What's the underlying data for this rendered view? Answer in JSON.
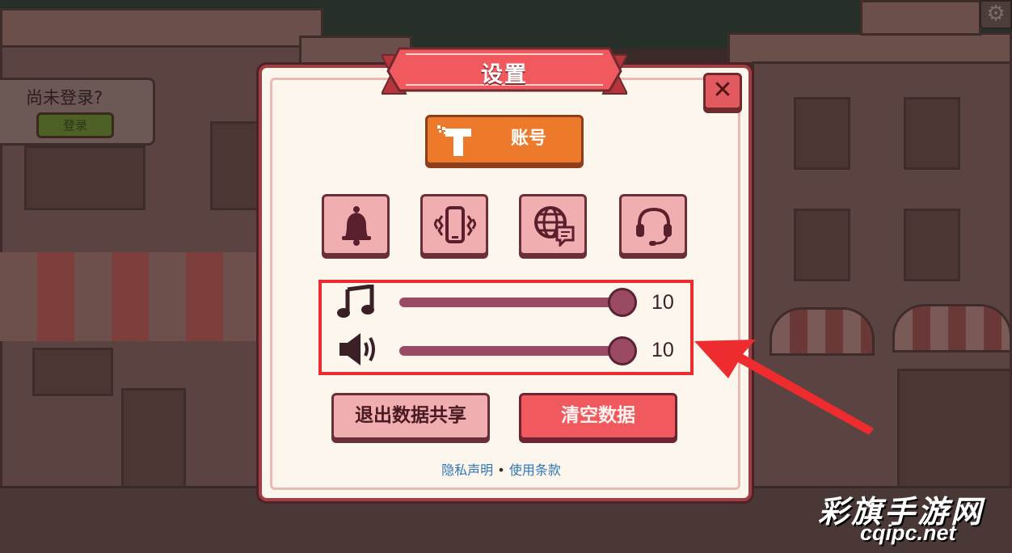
{
  "login": {
    "title": "尚未登录?",
    "button_label": "登录"
  },
  "dialog": {
    "title": "设置",
    "close_label": "✕",
    "account_button_label": "账号",
    "icon_buttons": [
      {
        "icon": "bell-icon",
        "meaning": "notifications"
      },
      {
        "icon": "vibration-icon",
        "meaning": "vibration"
      },
      {
        "icon": "globe-language-icon",
        "meaning": "language"
      },
      {
        "icon": "headset-icon",
        "meaning": "support"
      }
    ],
    "volume": {
      "music": {
        "icon": "music-note-icon",
        "value": "10",
        "level": 1.0
      },
      "sound": {
        "icon": "speaker-icon",
        "value": "10",
        "level": 1.0
      }
    },
    "exit_share_button_label": "退出数据共享",
    "clear_data_button_label": "清空数据",
    "privacy_link": "隐私声明",
    "separator": "•",
    "terms_link": "使用条款"
  },
  "watermark": {
    "site_name": "彩旗手游网",
    "url": "cqipc.net"
  },
  "colors": {
    "dialog_bg": "#fdf6ec",
    "ribbon": "#f05a5e",
    "account_orange": "#ec7a2a",
    "pink_button": "#f0aeb0",
    "red_button": "#f05a5e",
    "slider": "#9b4a63",
    "highlight": "#ee2b2f",
    "link": "#2c76b9"
  }
}
